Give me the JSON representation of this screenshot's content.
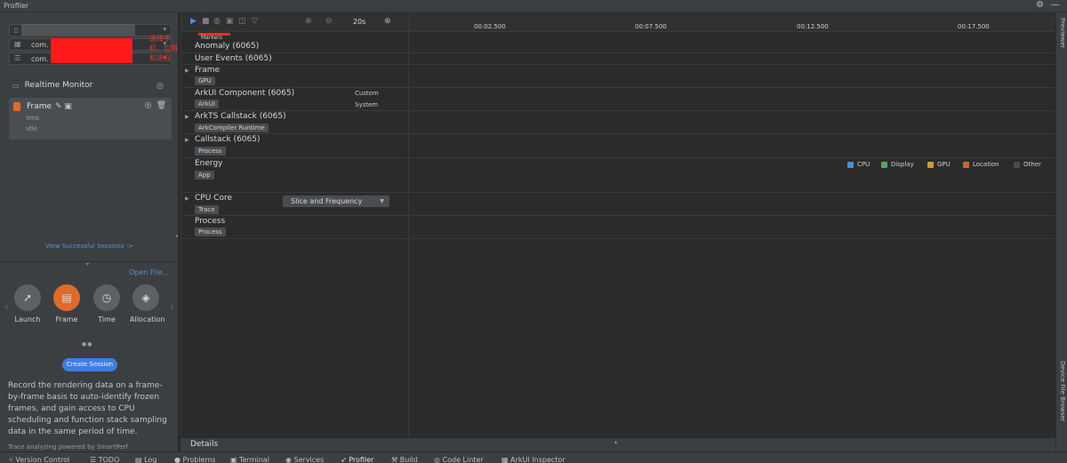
{
  "window": {
    "title": "Profiler"
  },
  "left": {
    "devices": [
      {
        "text": ""
      },
      {
        "text": "com."
      },
      {
        "text": "com."
      }
    ],
    "annotation_text": "选择手机，应用和进程",
    "monitor": {
      "title": "Realtime Monitor"
    },
    "session": {
      "name": "Frame",
      "time": "0ms",
      "status": "Idle"
    },
    "view_sessions_link": "View Successful Sessions ->",
    "open_file_link": "Open File...",
    "modes": [
      {
        "label": "Launch",
        "icon": "rocket-icon"
      },
      {
        "label": "Frame",
        "icon": "frame-icon"
      },
      {
        "label": "Time",
        "icon": "clock-icon"
      },
      {
        "label": "Allocation",
        "icon": "cube-icon"
      }
    ],
    "create_button": "Create Session",
    "description": "Record the rendering data on a frame-by-frame basis to auto-identify frozen frames, and gain access to CPU scheduling and function stack sampling data in the same period of time.",
    "powered_by": "Trace analyzing powered by SmartPerf"
  },
  "toolbar": {
    "duration": "20s",
    "ticks": [
      "00:02.500",
      "00:07.500",
      "00:12.500",
      "00:17.500"
    ]
  },
  "markers_label": "Markers",
  "lanes": [
    {
      "name": "Anomaly (6065)",
      "tag": "",
      "sub": []
    },
    {
      "name": "User Events (6065)",
      "tag": "",
      "sub": []
    },
    {
      "name": "Frame",
      "tag": "GPU",
      "sub": []
    },
    {
      "name": "ArkUI Component (6065)",
      "tag": "ArkUI",
      "sub": [
        "Custom",
        "System"
      ]
    },
    {
      "name": "ArkTS Callstack (6065)",
      "tag": "ArkCompiler Runtime",
      "sub": []
    },
    {
      "name": "Callstack (6065)",
      "tag": "Process",
      "sub": []
    },
    {
      "name": "Energy",
      "tag": "App",
      "sub": []
    },
    {
      "name": "CPU Core",
      "tag": "Trace",
      "sub": []
    },
    {
      "name": "Process",
      "tag": "Process",
      "sub": []
    }
  ],
  "energy_legend": [
    {
      "label": "CPU",
      "color": "#4a90c8"
    },
    {
      "label": "Display",
      "color": "#5aa55a"
    },
    {
      "label": "GPU",
      "color": "#c8a032"
    },
    {
      "label": "Location",
      "color": "#d0603a"
    },
    {
      "label": "Other",
      "color": "#4a4a4a"
    }
  ],
  "cpu_core_dropdown": "Slice and Frequency",
  "details_label": "Details",
  "right_strip": {
    "previewer": "Previewer",
    "device_file_browser": "Device File Browser"
  },
  "bottom_bar": [
    {
      "label": "Version Control",
      "icon": "branch-icon"
    },
    {
      "label": "TODO",
      "icon": "list-icon"
    },
    {
      "label": "Log",
      "icon": "log-icon"
    },
    {
      "label": "Problems",
      "icon": "problems-icon"
    },
    {
      "label": "Terminal",
      "icon": "terminal-icon"
    },
    {
      "label": "Services",
      "icon": "services-icon"
    },
    {
      "label": "Profiler",
      "icon": "profiler-icon"
    },
    {
      "label": "Build",
      "icon": "hammer-icon"
    },
    {
      "label": "Code Linter",
      "icon": "linter-icon"
    },
    {
      "label": "ArkUI Inspector",
      "icon": "inspector-icon"
    }
  ]
}
